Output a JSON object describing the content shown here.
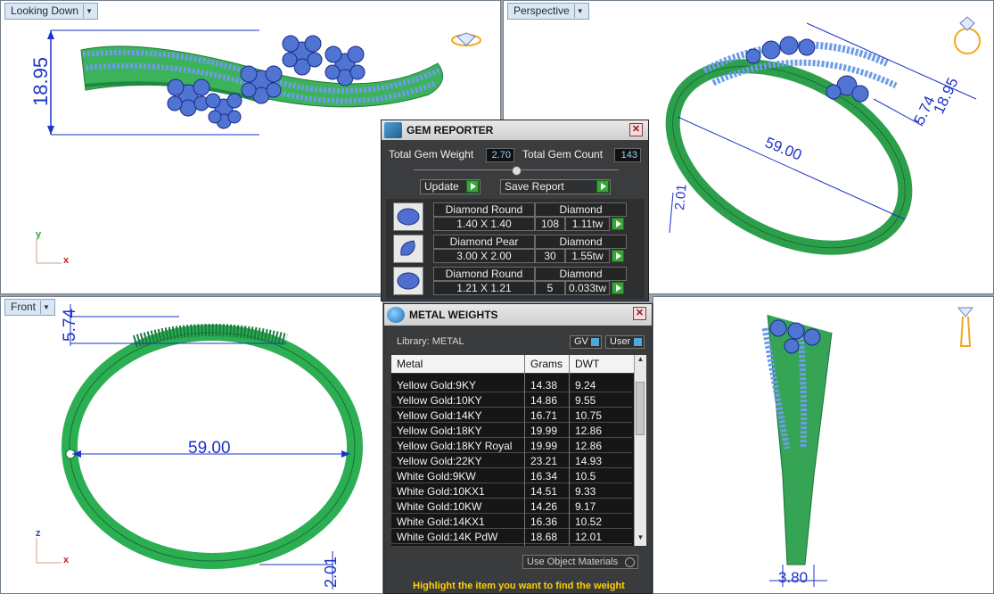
{
  "viewports": {
    "top_left": {
      "label": "Looking Down",
      "dims": [
        "18.95"
      ],
      "axes": [
        "y",
        "x"
      ]
    },
    "top_right": {
      "label": "Perspective",
      "dims": [
        "59.00",
        "5.74",
        "18.95",
        "2.01"
      ]
    },
    "bottom_left": {
      "label": "Front",
      "dims": [
        "59.00",
        "5.74",
        "2.01"
      ],
      "axes": [
        "z",
        "x"
      ]
    },
    "bottom_right": {
      "dims": [
        "3.80"
      ]
    }
  },
  "gem_reporter": {
    "title": "GEM REPORTER",
    "total_weight_label": "Total Gem Weight",
    "total_weight": "2.70",
    "total_count_label": "Total Gem Count",
    "total_count": "143",
    "update_label": "Update",
    "save_report_label": "Save Report",
    "gems": [
      {
        "name": "Diamond Round",
        "type": "Diamond",
        "size": "1.40 X 1.40",
        "count": "108",
        "tw": "1.11tw"
      },
      {
        "name": "Diamond Pear",
        "type": "Diamond",
        "size": "3.00 X 2.00",
        "count": "30",
        "tw": "1.55tw"
      },
      {
        "name": "Diamond Round",
        "type": "Diamond",
        "size": "1.21 X 1.21",
        "count": "5",
        "tw": "0.033tw"
      }
    ]
  },
  "metal_weights": {
    "title": "METAL WEIGHTS",
    "library_label": "Library: METAL",
    "gv_label": "GV",
    "user_label": "User",
    "columns": [
      "Metal",
      "Grams",
      "DWT"
    ],
    "rows": [
      [
        "Yellow Gold:9KY",
        "14.38",
        "9.24"
      ],
      [
        "Yellow Gold:10KY",
        "14.86",
        "9.55"
      ],
      [
        "Yellow Gold:14KY",
        "16.71",
        "10.75"
      ],
      [
        "Yellow Gold:18KY",
        "19.99",
        "12.86"
      ],
      [
        "Yellow Gold:18KY Royal",
        "19.99",
        "12.86"
      ],
      [
        "Yellow Gold:22KY",
        "23.21",
        "14.93"
      ],
      [
        "White Gold:9KW",
        "16.34",
        "10.5"
      ],
      [
        "White Gold:10KX1",
        "14.51",
        "9.33"
      ],
      [
        "White Gold:10KW",
        "14.26",
        "9.17"
      ],
      [
        "White Gold:14KX1",
        "16.36",
        "10.52"
      ],
      [
        "White Gold:14K PdW",
        "18.68",
        "12.01"
      ]
    ],
    "use_object_materials_label": "Use Object Materials",
    "hint": "Highlight the item you want to find the weight"
  },
  "colors": {
    "bracelet": "#2fae4e",
    "stone": "#4a78d6",
    "dimension": "#1d33c9"
  }
}
